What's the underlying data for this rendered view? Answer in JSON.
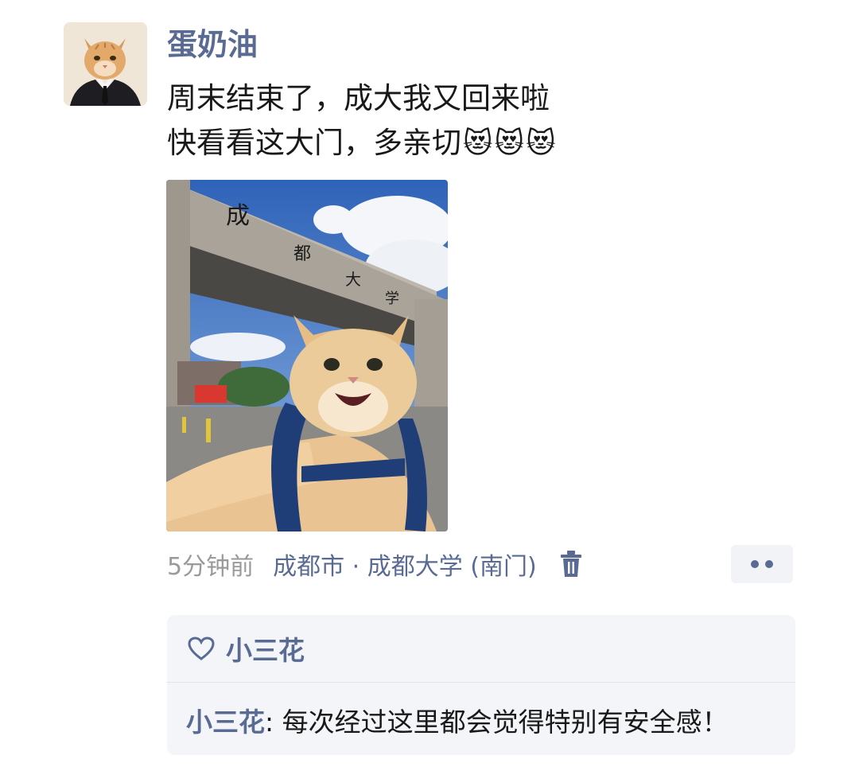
{
  "post": {
    "author": "蛋奶油",
    "text_line1": "周末结束了，成大我又回来啦",
    "text_line2": "快看看这大门，多亲切",
    "emojis": [
      "😻",
      "😻",
      "😻"
    ],
    "photo_sign_chars": [
      "成",
      "都",
      "大",
      "学"
    ],
    "time": "5分钟前",
    "location": "成都市 · 成都大学 (南门)"
  },
  "icons": {
    "delete": "trash-icon",
    "more": "more-dots-icon",
    "like": "heart-icon"
  },
  "likes": {
    "names": "小三花"
  },
  "comments": [
    {
      "author": "小三花",
      "separator": ": ",
      "text": "每次经过这里都会觉得特别有安全感！"
    }
  ],
  "colors": {
    "link": "#5a6b93",
    "time": "#9a9a9a",
    "comment_bg": "#f4f5f8",
    "text": "#191919"
  }
}
